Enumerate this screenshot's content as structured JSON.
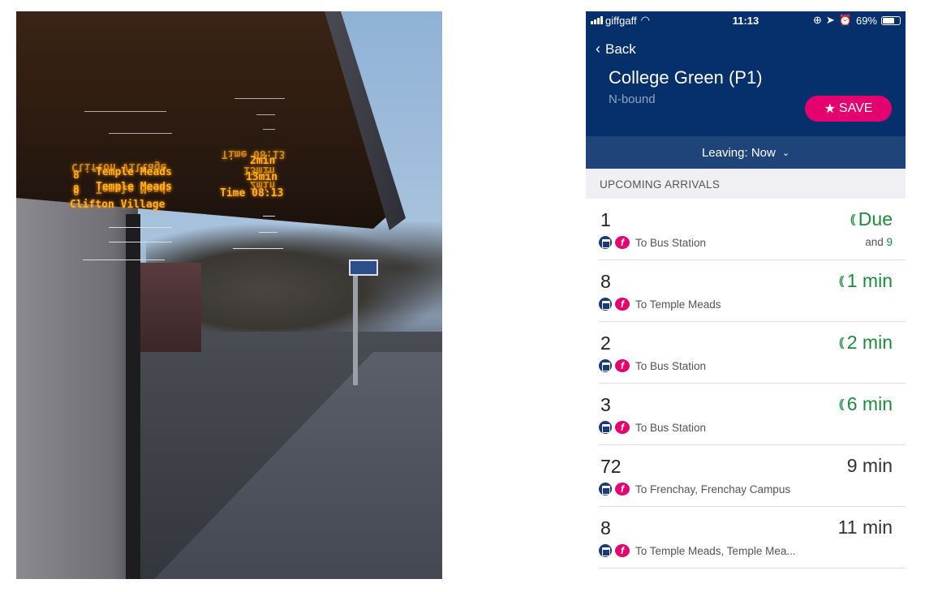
{
  "photo": {
    "sign": {
      "rows": [
        {
          "route": "8",
          "destination": "Temple Meads",
          "time": "2min"
        },
        {
          "route": "8",
          "destination": "Temple Meads",
          "time": "13min"
        }
      ],
      "stop_name": "Clifton Village",
      "clock": "Time 08:13",
      "reflection": [
        "Clifton Village",
        "Time 08:13",
        "13min",
        "2min",
        "8",
        "Temple Meads"
      ]
    }
  },
  "app": {
    "status_bar": {
      "carrier": "giffgaff",
      "time": "11:13",
      "battery": "69%",
      "battery_level": 0.69
    },
    "header": {
      "back_label": "Back",
      "stop_title": "College Green (P1)",
      "direction": "N-bound",
      "save_label": "SAVE"
    },
    "leaving": {
      "label": "Leaving: Now"
    },
    "section_title": "UPCOMING ARRIVALS",
    "colors": {
      "header": "#05306c",
      "leaving_bar": "#1f4479",
      "save": "#e5006f",
      "live": "#1e8a3c"
    },
    "arrivals": [
      {
        "route": "1",
        "destination": "To Bus Station",
        "eta": "Due",
        "live": true,
        "also_prefix": "and",
        "also": "9"
      },
      {
        "route": "8",
        "destination": "To Temple Meads",
        "eta": "1 min",
        "live": true
      },
      {
        "route": "2",
        "destination": "To Bus Station",
        "eta": "2 min",
        "live": true
      },
      {
        "route": "3",
        "destination": "To Bus Station",
        "eta": "6 min",
        "live": true
      },
      {
        "route": "72",
        "destination": "To Frenchay, Frenchay Campus",
        "eta": "9 min",
        "live": false
      },
      {
        "route": "8",
        "destination": "To Temple Meads, Temple Mea...",
        "eta": "11 min",
        "live": false
      }
    ]
  }
}
